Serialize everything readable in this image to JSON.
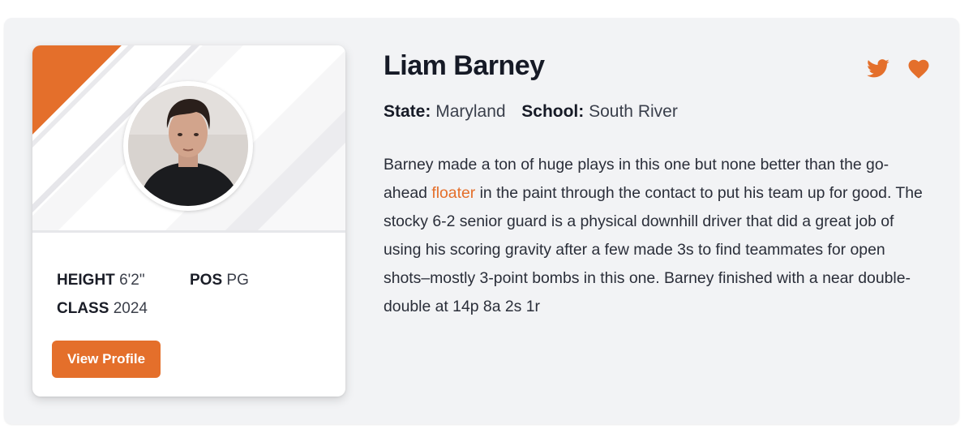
{
  "player": {
    "name": "Liam Barney",
    "state_label": "State:",
    "state": "Maryland",
    "school_label": "School:",
    "school": "South River"
  },
  "stats": {
    "height_label": "HEIGHT",
    "height": "6'2\"",
    "pos_label": "POS",
    "pos": "PG",
    "class_label": "CLASS",
    "class": "2024"
  },
  "actions": {
    "view_profile": "View Profile"
  },
  "icons": {
    "twitter": "twitter-icon",
    "favorite": "heart-icon"
  },
  "description": {
    "part1": "Barney made a ton of huge plays in this one but none better than the go-ahead ",
    "highlight": "floater",
    "part2": " in the paint through the contact to put his team up for good. The stocky 6-2 senior guard is a physical downhill driver that did a great job of using his scoring gravity after a few made 3s to find teammates for open shots–mostly 3-point bombs in this one. Barney finished with a near double-double at 14p 8a 2s 1r"
  },
  "colors": {
    "accent": "#e46f2b",
    "panel_bg": "#f2f3f5",
    "card_bg": "#ffffff"
  }
}
